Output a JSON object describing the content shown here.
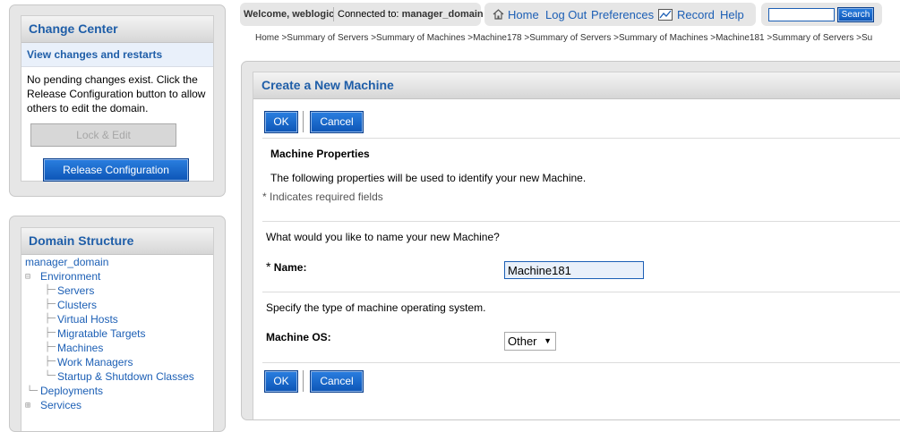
{
  "change_center": {
    "title": "Change Center",
    "subtitle": "View changes and restarts",
    "message": "No pending changes exist. Click the Release Configuration button to allow others to edit the domain.",
    "lock_button": "Lock & Edit",
    "release_button": "Release Configuration"
  },
  "domain_structure": {
    "title": "Domain Structure",
    "root": "manager_domain",
    "environment": "Environment",
    "environment_children": [
      "Servers",
      "Clusters",
      "Virtual Hosts",
      "Migratable Targets",
      "Machines",
      "Work Managers",
      "Startup & Shutdown Classes"
    ],
    "deployments": "Deployments",
    "services": "Services"
  },
  "toolbar": {
    "welcome_label": "Welcome,",
    "user": "weblogic",
    "connected_label": "Connected to:",
    "domain": "manager_domain",
    "home": "Home",
    "logout": "Log Out",
    "preferences": "Preferences",
    "record": "Record",
    "help": "Help",
    "search_button": "Search",
    "search_value": ""
  },
  "breadcrumb": "Home >Summary of Servers >Summary of Machines >Machine178 >Summary of Servers >Summary of Machines >Machine181 >Summary of Servers >Su",
  "form": {
    "title": "Create a New Machine",
    "ok": "OK",
    "cancel": "Cancel",
    "section_title": "Machine Properties",
    "section_desc": "The following properties will be used to identify your new Machine.",
    "required_note": "* Indicates required fields",
    "name_question": "What would you like to name your new Machine?",
    "name_asterisk": "*",
    "name_label": "Name:",
    "name_value": "Machine181",
    "os_question": "Specify the type of machine operating system.",
    "os_label": "Machine OS:",
    "os_value": "Other"
  }
}
